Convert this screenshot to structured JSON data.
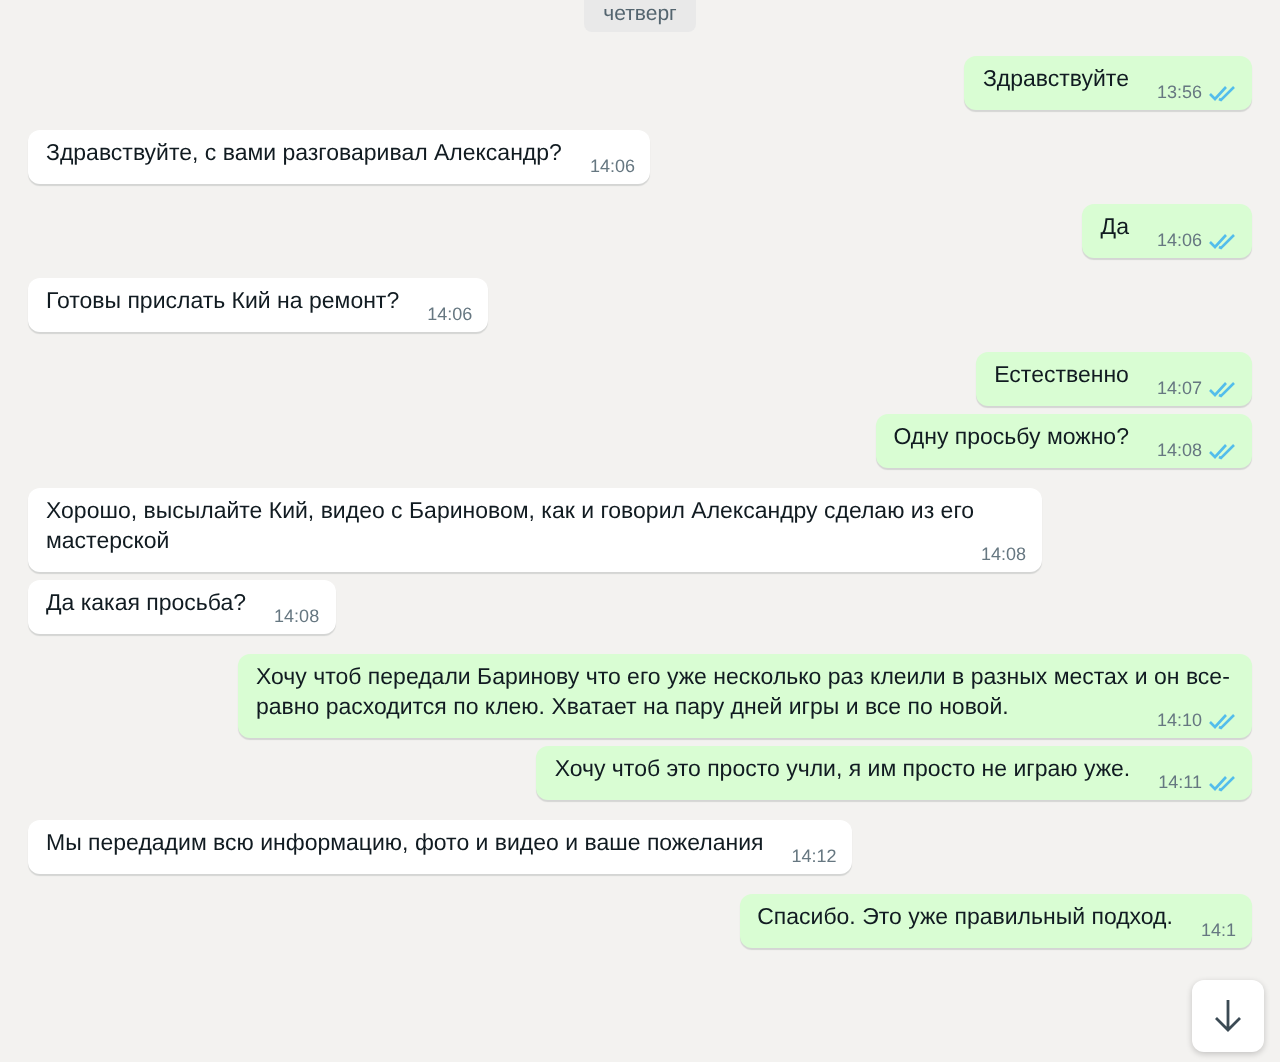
{
  "date_label": "четверг",
  "messages": [
    {
      "outgoing": true,
      "text": "Здравствуйте",
      "time": "13:56",
      "read": true
    },
    {
      "outgoing": false,
      "text": "Здравствуйте, с вами разговаривал Александр?",
      "time": "14:06"
    },
    {
      "outgoing": true,
      "text": "Да",
      "time": "14:06",
      "read": true
    },
    {
      "outgoing": false,
      "text": "Готовы прислать Кий на ремонт?",
      "time": "14:06"
    },
    {
      "outgoing": true,
      "text": "Естественно",
      "time": "14:07",
      "read": true
    },
    {
      "outgoing": true,
      "text": "Одну просьбу можно?",
      "time": "14:08",
      "read": true
    },
    {
      "outgoing": false,
      "text": "Хорошо, высылайте Кий, видео с Бариновом, как и говорил Александру сделаю из его мастерской",
      "time": "14:08"
    },
    {
      "outgoing": false,
      "text": "Да какая просьба?",
      "time": "14:08"
    },
    {
      "outgoing": true,
      "text": "Хочу чтоб передали Баринову что его уже несколько раз клеили в разных местах и он все-равно расходится по клею. Хватает на пару дней игры и все по новой.",
      "time": "14:10",
      "read": true
    },
    {
      "outgoing": true,
      "text": "Хочу чтоб это просто учли, я им просто не играю уже.",
      "time": "14:11",
      "read": true
    },
    {
      "outgoing": false,
      "text": "Мы передадим всю информацию, фото и видео и ваше пожелания",
      "time": "14:12"
    },
    {
      "outgoing": true,
      "text": "Спасибо. Это уже правильный подход.",
      "time": "14:1"
    }
  ]
}
